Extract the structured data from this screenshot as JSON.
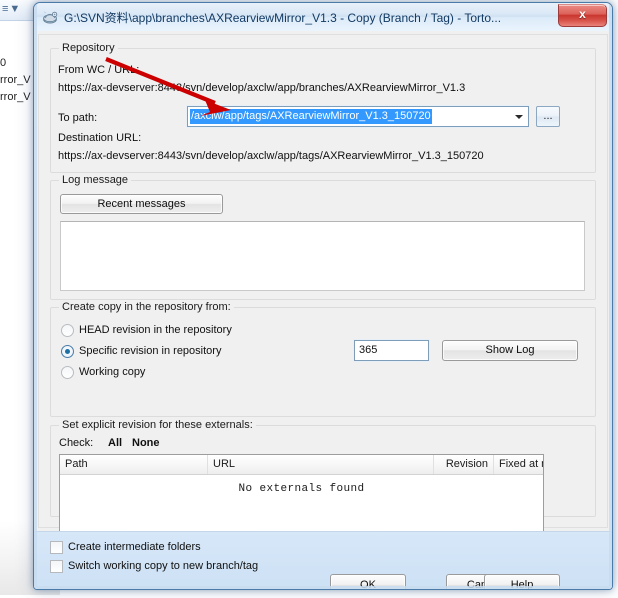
{
  "window": {
    "title": "G:\\SVN资料\\app\\branches\\AXRearviewMirror_V1.3 - Copy (Branch / Tag) - Torto...",
    "close_label": "x",
    "app_icon": "tortoisesvn-icon"
  },
  "background": {
    "list_items": [
      "0",
      "rror_V",
      "rror_V"
    ]
  },
  "repository": {
    "group_title": "Repository",
    "from_label": "From WC / URL:",
    "from_url": "https://ax-devserver:8443/svn/develop/axclw/app/branches/AXRearviewMirror_V1.3",
    "to_path_label": "To path:",
    "to_path_value": "/axclw/app/tags/AXRearviewMirror_V1.3_150720",
    "browse_label": "...",
    "destination_label": "Destination URL:",
    "destination_url": "https://ax-devserver:8443/svn/develop/axclw/app/tags/AXRearviewMirror_V1.3_150720"
  },
  "log_message": {
    "group_title": "Log message",
    "recent_messages_label": "Recent messages",
    "text": "",
    "placeholder": ""
  },
  "create_copy": {
    "group_title": "Create copy in the repository from:",
    "options": [
      {
        "label": "HEAD revision in the repository",
        "selected": false
      },
      {
        "label": "Specific revision in repository",
        "selected": true
      },
      {
        "label": "Working copy",
        "selected": false
      }
    ],
    "revision_value": "365",
    "show_log_label": "Show Log"
  },
  "externals": {
    "group_title": "Set explicit revision for these externals:",
    "check_label": "Check:",
    "check_all_label": "All",
    "check_none_label": "None",
    "columns": [
      "Path",
      "URL",
      "Revision",
      "Fixed at rev"
    ],
    "rows": [],
    "empty_text": "No externals found"
  },
  "footer": {
    "checkboxes": [
      {
        "label": "Create intermediate folders",
        "checked": false
      },
      {
        "label": "Switch working copy to new branch/tag",
        "checked": false
      }
    ],
    "ok_label": "OK",
    "cancel_label": "Cancel",
    "help_label": "Help"
  },
  "annotation": {
    "arrow_color": "#cc0000",
    "arrow_name": "red-annotation-arrow"
  }
}
